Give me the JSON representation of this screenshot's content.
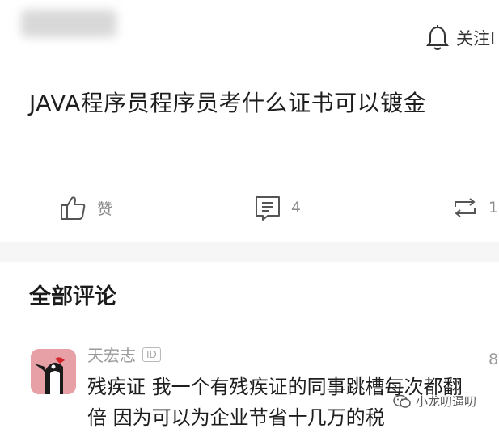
{
  "header": {
    "follow_label": "关注I"
  },
  "post": {
    "title": "JAVA程序员程序员考什么证书可以镀金"
  },
  "actions": {
    "like_label": "赞",
    "comment_count": "4",
    "repost_count": "1"
  },
  "comments_section": {
    "title": "全部评论",
    "comments": [
      {
        "username": "天宏志",
        "badge": "ID",
        "time": "8",
        "line1": "残疾证 我一个有残疾证的同事跳槽每次都翻",
        "line2": "倍 因为可以为企业节省十几万的税"
      }
    ]
  },
  "watermark": {
    "text": "小龙叨逼叨"
  },
  "colors": {
    "background": "#ffffff",
    "divider": "#f6f6f6",
    "muted_text": "#8a8a8a",
    "avatar_bg": "#e6a0a6"
  }
}
